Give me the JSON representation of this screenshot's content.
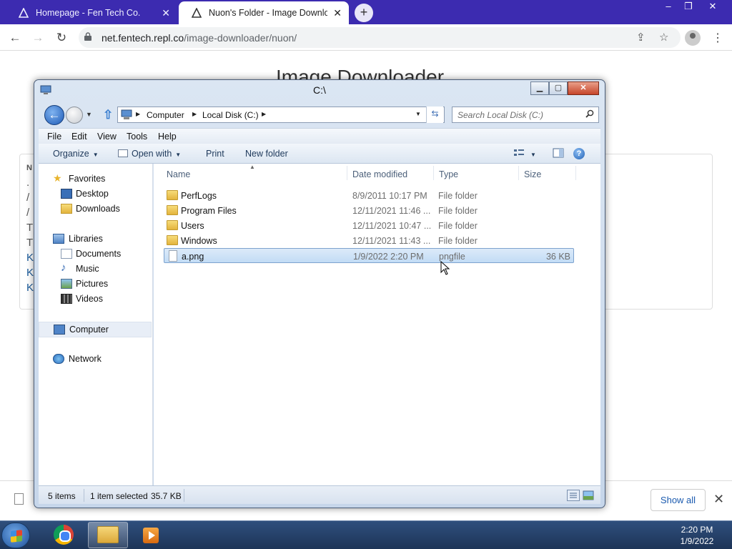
{
  "browser": {
    "tabs": [
      {
        "title": "Homepage - Fen Tech Co.",
        "active": false
      },
      {
        "title": "Nuon's Folder - Image Downloader",
        "active": true
      }
    ],
    "new_tab_label": "+",
    "window_controls": {
      "minimize": "–",
      "restore": "❐",
      "close": "✕"
    },
    "url_host": "net.fentech.repl.co",
    "url_path": "/image-downloader/nuon/"
  },
  "webpage": {
    "heading": "Image Downloader",
    "partial_left_letters": [
      ".",
      "/",
      "/",
      "T",
      "T",
      "K",
      "K",
      "K"
    ],
    "card_label_fragment": "N",
    "download_bar": {
      "show_all": "Show all",
      "close": "✕"
    }
  },
  "explorer": {
    "title": "C:\\",
    "address": {
      "crumbs": [
        "Computer",
        "Local Disk (C:)"
      ]
    },
    "search_placeholder": "Search Local Disk (C:)",
    "menu": [
      "File",
      "Edit",
      "View",
      "Tools",
      "Help"
    ],
    "commands": {
      "organize": "Organize",
      "open_with": "Open with",
      "print": "Print",
      "new_folder": "New folder"
    },
    "nav": {
      "favorites": "Favorites",
      "desktop": "Desktop",
      "downloads": "Downloads",
      "libraries": "Libraries",
      "documents": "Documents",
      "music": "Music",
      "pictures": "Pictures",
      "videos": "Videos",
      "computer": "Computer",
      "network": "Network"
    },
    "columns": {
      "name": "Name",
      "date": "Date modified",
      "type": "Type",
      "size": "Size"
    },
    "files": [
      {
        "name": "PerfLogs",
        "date": "8/9/2011 10:17 PM",
        "type": "File folder",
        "size": "",
        "kind": "folder"
      },
      {
        "name": "Program Files",
        "date": "12/11/2021 11:46 ...",
        "type": "File folder",
        "size": "",
        "kind": "folder"
      },
      {
        "name": "Users",
        "date": "12/11/2021 10:47 ...",
        "type": "File folder",
        "size": "",
        "kind": "folder"
      },
      {
        "name": "Windows",
        "date": "12/11/2021 11:43 ...",
        "type": "File folder",
        "size": "",
        "kind": "folder"
      },
      {
        "name": "a.png",
        "date": "1/9/2022 2:20 PM",
        "type": "pngfile",
        "size": "36 KB",
        "kind": "file",
        "selected": true
      }
    ],
    "status": {
      "count": "5 items",
      "selected": "1 item selected",
      "size": "35.7 KB"
    }
  },
  "taskbar": {
    "time": "2:20 PM",
    "date": "1/9/2022"
  }
}
